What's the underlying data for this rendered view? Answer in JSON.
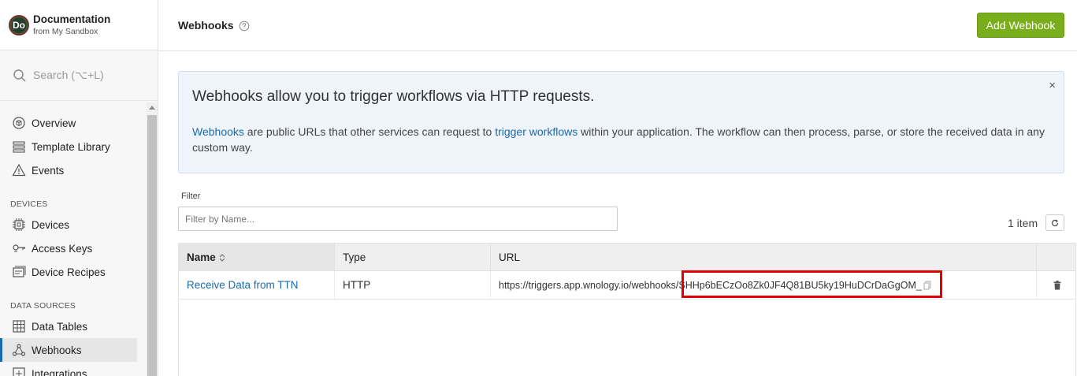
{
  "app": {
    "avatar_text": "Do",
    "name": "Documentation",
    "subtitle": "from My Sandbox"
  },
  "search": {
    "placeholder": "Search (⌥+L)"
  },
  "sidebar": {
    "items_top": [
      {
        "label": "Overview",
        "icon": "overview-icon"
      },
      {
        "label": "Template Library",
        "icon": "template-library-icon"
      },
      {
        "label": "Events",
        "icon": "events-warning-icon"
      }
    ],
    "devices_section": "DEVICES",
    "items_devices": [
      {
        "label": "Devices",
        "icon": "chip-icon"
      },
      {
        "label": "Access Keys",
        "icon": "key-icon"
      },
      {
        "label": "Device Recipes",
        "icon": "recipe-icon"
      }
    ],
    "data_sources_section": "DATA SOURCES",
    "items_data": [
      {
        "label": "Data Tables",
        "icon": "table-icon"
      },
      {
        "label": "Webhooks",
        "icon": "webhook-icon",
        "active": true
      },
      {
        "label": "Integrations",
        "icon": "integrations-icon"
      }
    ]
  },
  "page": {
    "title": "Webhooks",
    "add_button": "Add Webhook"
  },
  "info": {
    "title": "Webhooks allow you to trigger workflows via HTTP requests.",
    "link1": "Webhooks",
    "text1": " are public URLs that other services can request to ",
    "link2": "trigger workflows",
    "text2": " within your application. The workflow can then process, parse, or store the received data in any custom way.",
    "close": "×"
  },
  "filter": {
    "label": "Filter",
    "placeholder": "Filter by Name..."
  },
  "count": "1 item",
  "table": {
    "headers": {
      "name": "Name",
      "type": "Type",
      "url": "URL"
    },
    "rows": [
      {
        "name": "Receive Data from TTN",
        "type": "HTTP",
        "url": "https://triggers.app.wnology.io/webhooks/SHHp6bECzOo8Zk0JF4Q81BU5ky19HuDCrDaGgOM_"
      }
    ]
  },
  "colors": {
    "accent": "#1a6aa8",
    "add_button": "#79ad1c",
    "highlight": "#e00000"
  }
}
